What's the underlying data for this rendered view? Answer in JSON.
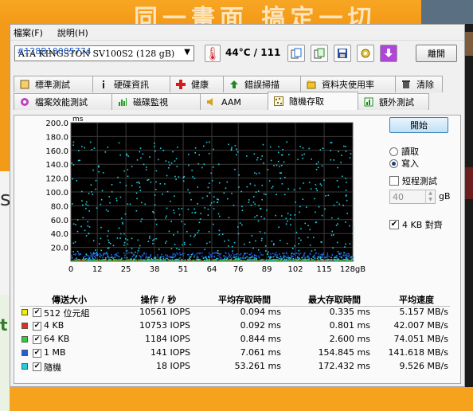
{
  "background": {
    "banner_text": "同一畫面 搞定一切"
  },
  "menu": [
    "檔案(F)",
    "說明(H)"
  ],
  "toolbar": {
    "drive": "ATA   KINGSTON SV100S2 (128 gB)",
    "serial": "#128B10005774",
    "temperature": "44°C / 111",
    "exit_label": "離開"
  },
  "tabs_row1": [
    {
      "label": "標準測試",
      "icon": "benchmark-icon"
    },
    {
      "label": "硬碟資訊",
      "icon": "info-icon"
    },
    {
      "label": "健康",
      "icon": "health-icon"
    },
    {
      "label": "錯誤掃描",
      "icon": "error-scan-icon"
    },
    {
      "label": "資料夾使用率",
      "icon": "folder-icon"
    },
    {
      "label": "清除",
      "icon": "trash-icon"
    }
  ],
  "tabs_row2": [
    {
      "label": "檔案效能測試",
      "icon": "file-bench-icon"
    },
    {
      "label": "磁碟監視",
      "icon": "monitor-icon"
    },
    {
      "label": "AAM",
      "icon": "speaker-icon"
    },
    {
      "label": "隨機存取",
      "icon": "random-access-icon",
      "active": true
    },
    {
      "label": "額外測試",
      "icon": "extra-tests-icon"
    }
  ],
  "controls": {
    "start_label": "開始",
    "read_label": "讀取",
    "write_label": "寫入",
    "mode_selected": "write",
    "short_test_label": "短程測試",
    "short_test_checked": false,
    "short_test_value": "40",
    "unit_label": "gB",
    "align_label": "4 KB 對齊",
    "align_checked": true
  },
  "chart_data": {
    "type": "scatter",
    "ylabel": "ms",
    "xlabel": "",
    "ylim": [
      0,
      200
    ],
    "xlim": [
      0,
      128
    ],
    "y_ticks": [
      "200.0",
      "180.0",
      "160.0",
      "140.0",
      "120.0",
      "100.0",
      "80.0",
      "60.0",
      "40.0",
      "20.0"
    ],
    "x_ticks": [
      "0",
      "12",
      "25",
      "38",
      "51",
      "64",
      "76",
      "89",
      "102",
      "115",
      "128gB"
    ],
    "background": "#000000",
    "series": [
      {
        "name": "512 位元組",
        "color": "#f0f000",
        "y_range": [
          0.05,
          0.35
        ]
      },
      {
        "name": "4 KB",
        "color": "#e03020",
        "y_range": [
          0.05,
          0.8
        ]
      },
      {
        "name": "64 KB",
        "color": "#30d030",
        "y_range": [
          0.5,
          2.6
        ]
      },
      {
        "name": "1 MB",
        "color": "#2060e0",
        "y_range": [
          4,
          12
        ]
      },
      {
        "name": "隨機",
        "color": "#20d0e0",
        "y_range": [
          0.1,
          172.4
        ]
      }
    ]
  },
  "results": {
    "headers": [
      "傳送大小",
      "操作 / 秒",
      "平均存取時間",
      "最大存取時間",
      "平均速度"
    ],
    "rows": [
      {
        "size": "512 位元組",
        "ops": "10561 IOPS",
        "avg": "0.094 ms",
        "max": "0.335 ms",
        "speed": "5.157 MB/s",
        "color": "#f0f000"
      },
      {
        "size": "4 KB",
        "ops": "10753 IOPS",
        "avg": "0.092 ms",
        "max": "0.801 ms",
        "speed": "42.007 MB/s",
        "color": "#e03020"
      },
      {
        "size": "64 KB",
        "ops": "1184 IOPS",
        "avg": "0.844 ms",
        "max": "2.600 ms",
        "speed": "74.051 MB/s",
        "color": "#30d030"
      },
      {
        "size": "1 MB",
        "ops": "141 IOPS",
        "avg": "7.061 ms",
        "max": "154.845 ms",
        "speed": "141.618 MB/s",
        "color": "#2060e0"
      },
      {
        "size": "隨機",
        "ops": "18 IOPS",
        "avg": "53.261 ms",
        "max": "172.432 ms",
        "speed": "9.526 MB/s",
        "color": "#20d0e0"
      }
    ]
  }
}
